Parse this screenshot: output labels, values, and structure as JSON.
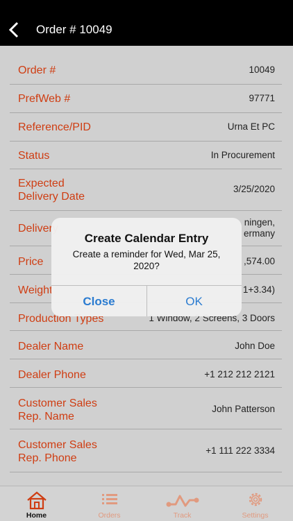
{
  "header": {
    "title": "Order # 10049"
  },
  "rows": [
    {
      "label": "Order #",
      "value": "10049"
    },
    {
      "label": "PrefWeb #",
      "value": "97771"
    },
    {
      "label": "Reference/PID",
      "value": "Urna Et PC"
    },
    {
      "label": "Status",
      "value": "In Procurement"
    },
    {
      "label": "Expected\nDelivery Date",
      "value": "3/25/2020"
    },
    {
      "label": "Delivery",
      "value": "ningen,\nermany"
    },
    {
      "label": "Price",
      "value": ",574.00"
    },
    {
      "label": "Weight",
      "value": "1+3.34)"
    },
    {
      "label": "Production Types",
      "value": "1 Window, 2 Screens, 3 Doors"
    },
    {
      "label": "Dealer Name",
      "value": "John Doe"
    },
    {
      "label": "Dealer Phone",
      "value": "+1 212 212 2121"
    },
    {
      "label": "Customer Sales\nRep. Name",
      "value": "John Patterson"
    },
    {
      "label": "Customer Sales\nRep. Phone",
      "value": "+1 111 222 3334"
    }
  ],
  "alert": {
    "title": "Create Calendar Entry",
    "message": "Create a reminder for Wed, Mar 25, 2020?",
    "close_label": "Close",
    "ok_label": "OK"
  },
  "tabs": [
    {
      "label": "Home",
      "icon": "home-icon",
      "active": true
    },
    {
      "label": "Orders",
      "icon": "list-icon",
      "active": false
    },
    {
      "label": "Track",
      "icon": "track-icon",
      "active": false
    },
    {
      "label": "Settings",
      "icon": "gear-icon",
      "active": false
    }
  ],
  "colors": {
    "accent": "#cf3d12",
    "tab_inactive": "#e19a7f",
    "link_blue": "#2a7bd0"
  }
}
